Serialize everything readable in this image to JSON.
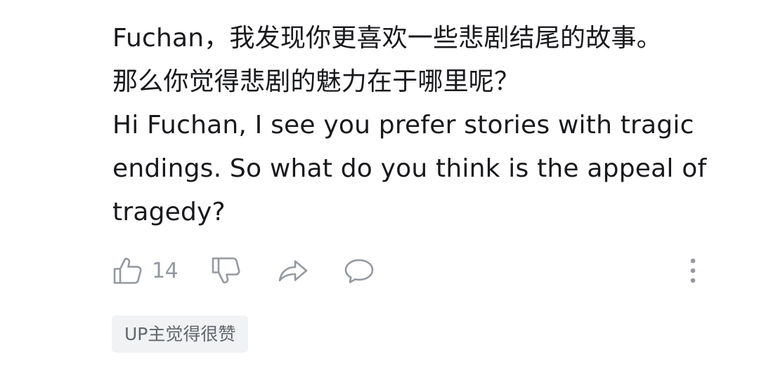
{
  "comment": {
    "text": "Fuchan，我发现你更喜欢一些悲剧结尾的故事。\n那么你觉得悲剧的魅力在于哪里呢？\nHi Fuchan, I see you prefer stories with tragic endings. So what do you think is the appeal of tragedy?"
  },
  "actions": {
    "like_icon": "thumbs-up-icon",
    "like_count": "14",
    "dislike_icon": "thumbs-down-icon",
    "share_icon": "share-arrow-icon",
    "reply_icon": "speech-bubble-icon",
    "more_icon": "vertical-ellipsis-icon",
    "icon_color": "#9499a0"
  },
  "tag": {
    "label": "UP主觉得很赞"
  }
}
